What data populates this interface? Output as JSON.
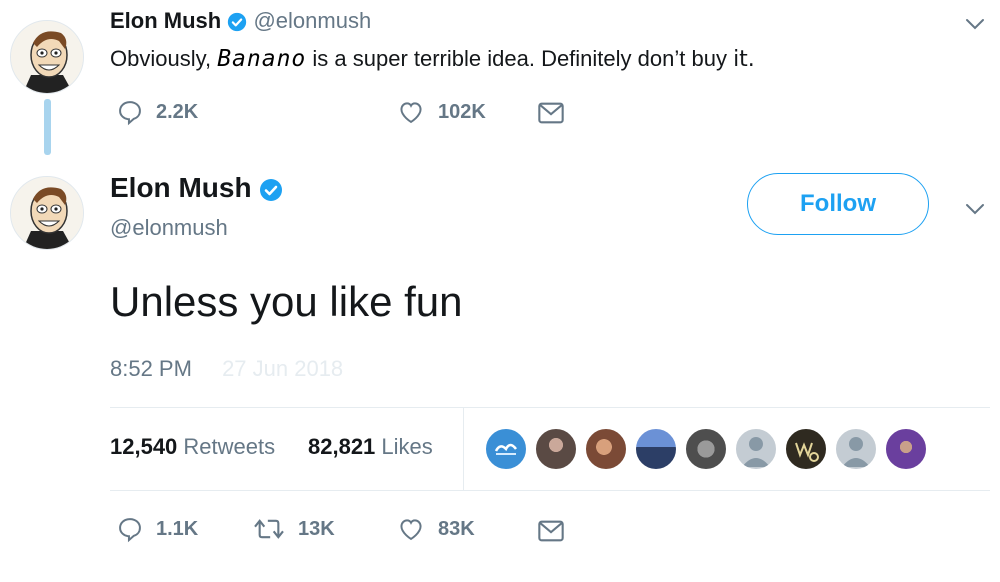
{
  "tweet1": {
    "name": "Elon Mush",
    "handle": "@elonmush",
    "text_before": "Obviously, ",
    "text_scribble": "Banano",
    "text_after": " is a super terrible idea. Definitely don’t buy ",
    "text_end": "it.",
    "replies": "2.2K",
    "likes": "102K"
  },
  "tweet2": {
    "name": "Elon Mush",
    "handle": "@elonmush",
    "follow_label": "Follow",
    "text": "Unless you like fun",
    "time": "8:52 PM",
    "date_ghost": "27 Jun 2018",
    "retweets_num": "12,540",
    "retweets_label": "Retweets",
    "likes_num": "82,821",
    "likes_label": "Likes",
    "replies": "1.1K",
    "retweets_short": "13K",
    "likes_short": "83K"
  },
  "colors": {
    "verified": "#1da1f2",
    "muted": "#657786",
    "thread_line": "#a8d4ee",
    "follow": "#1da1f2"
  },
  "likers": [
    {
      "icon": "blue-logo-avatar",
      "color": "#3a8fd6"
    },
    {
      "icon": "photo-avatar",
      "color": "#5a4a44"
    },
    {
      "icon": "photo-avatar",
      "color": "#7b4a36"
    },
    {
      "icon": "photo-avatar",
      "color": "#4b6fb0"
    },
    {
      "icon": "photo-avatar",
      "color": "#6a6a6a"
    },
    {
      "icon": "default-avatar",
      "color": "#c4ccd3"
    },
    {
      "icon": "text-avatar",
      "color": "#2f2a20"
    },
    {
      "icon": "default-avatar",
      "color": "#c4ccd3"
    },
    {
      "icon": "purple-photo-avatar",
      "color": "#6a3f9e"
    }
  ]
}
